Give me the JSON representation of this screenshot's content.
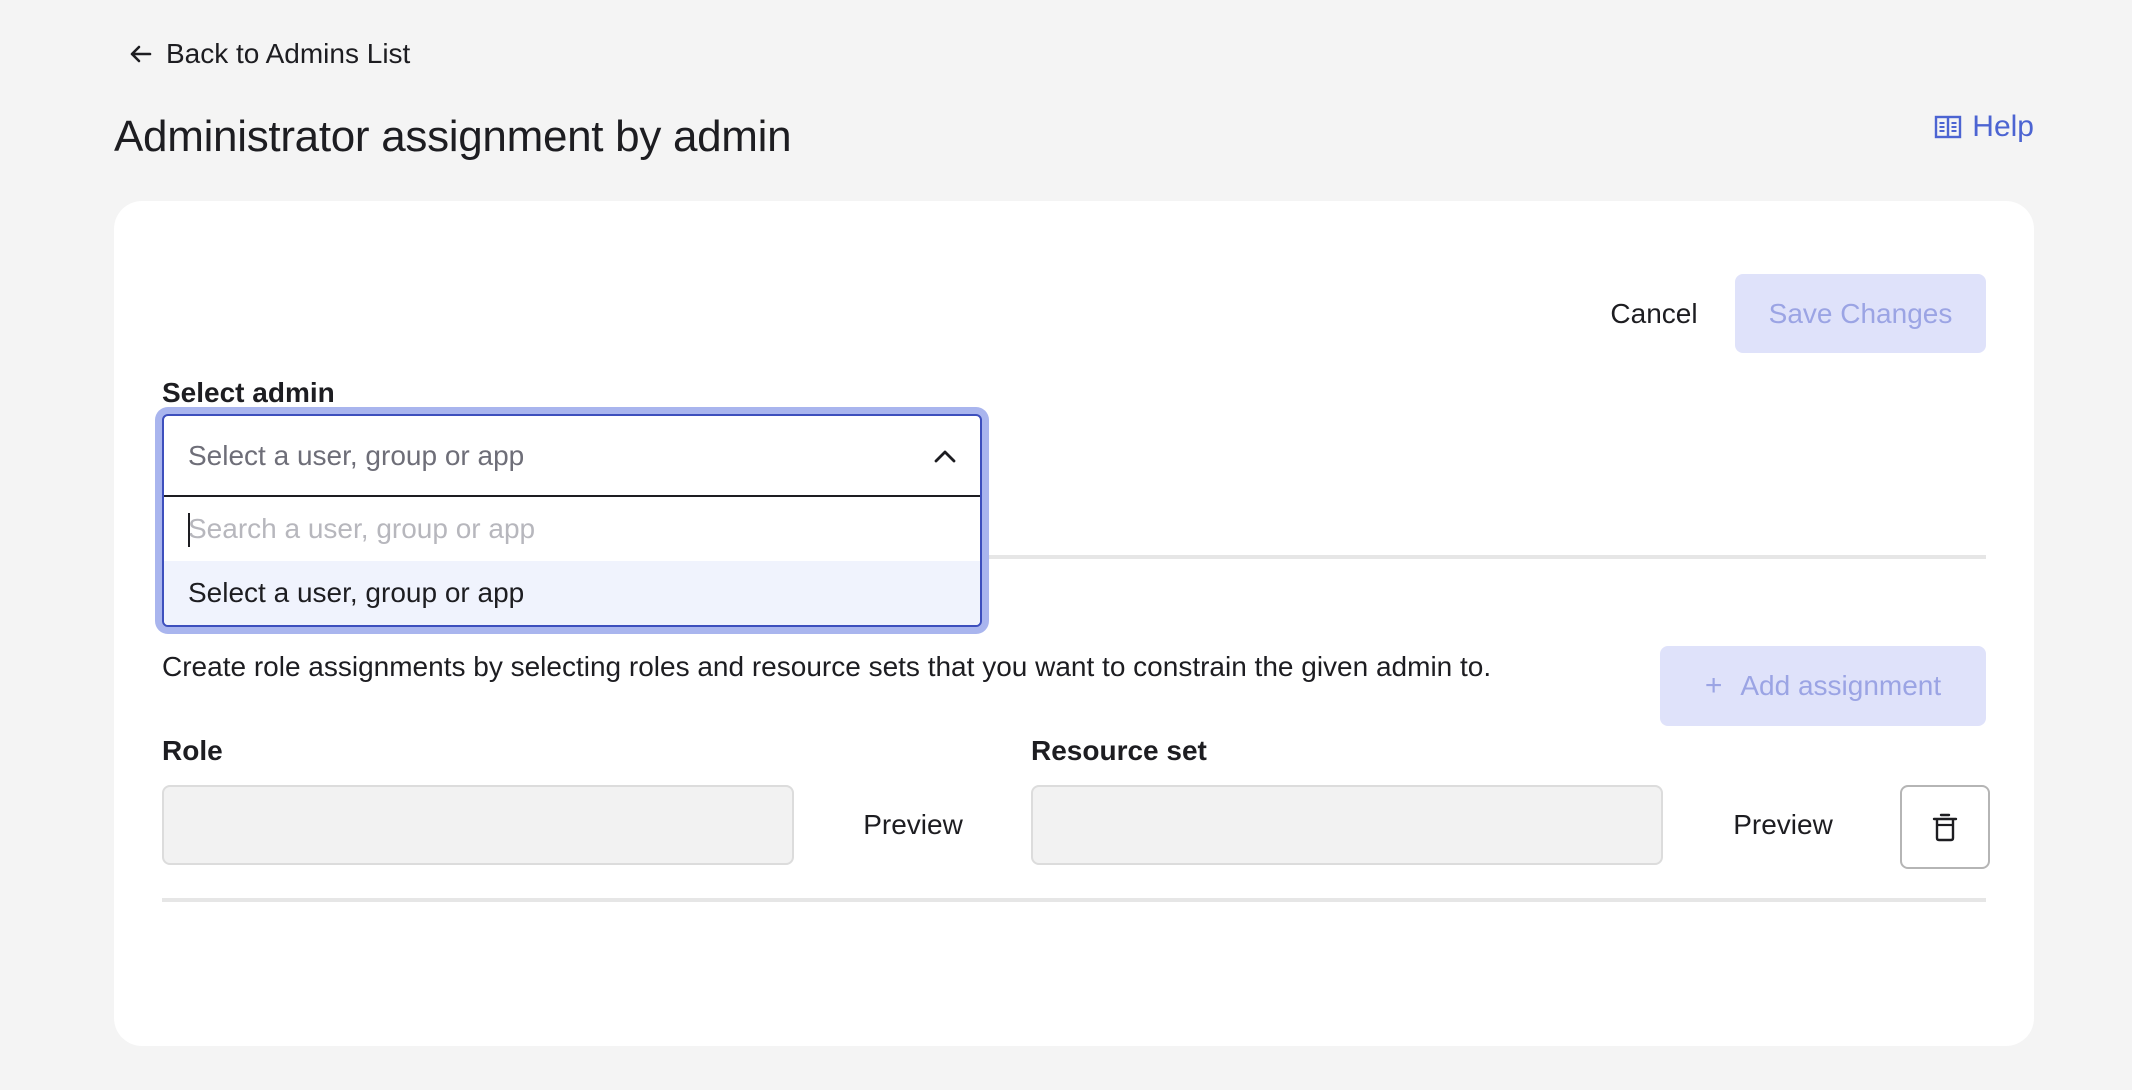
{
  "nav": {
    "back_label": "Back to Admins List"
  },
  "page": {
    "title": "Administrator assignment by admin",
    "help_label": "Help"
  },
  "actions": {
    "cancel_label": "Cancel",
    "save_label": "Save Changes"
  },
  "admin_select": {
    "label": "Select admin",
    "placeholder": "Select a user, group or app",
    "search_placeholder": "Search a user, group or app",
    "options": [
      "Select a user, group or app"
    ]
  },
  "assignments": {
    "description": "Create role assignments by selecting roles and resource sets that you want to constrain the given admin to.",
    "add_label": "Add assignment",
    "role_label": "Role",
    "resource_set_label": "Resource set",
    "preview_label": "Preview"
  },
  "icons": {
    "back": "arrow-left-icon",
    "help": "book-icon",
    "chevron": "chevron-up-icon",
    "add": "plus-icon",
    "delete": "trash-icon"
  },
  "colors": {
    "page_bg": "#f4f4f4",
    "card_bg": "#ffffff",
    "accent": "#4c64d2",
    "disabled_button_bg": "#dfe2fa",
    "disabled_button_text": "#9ba4e4",
    "focus_ring": "#a9b5ee",
    "option_highlight": "#f0f3fd"
  }
}
